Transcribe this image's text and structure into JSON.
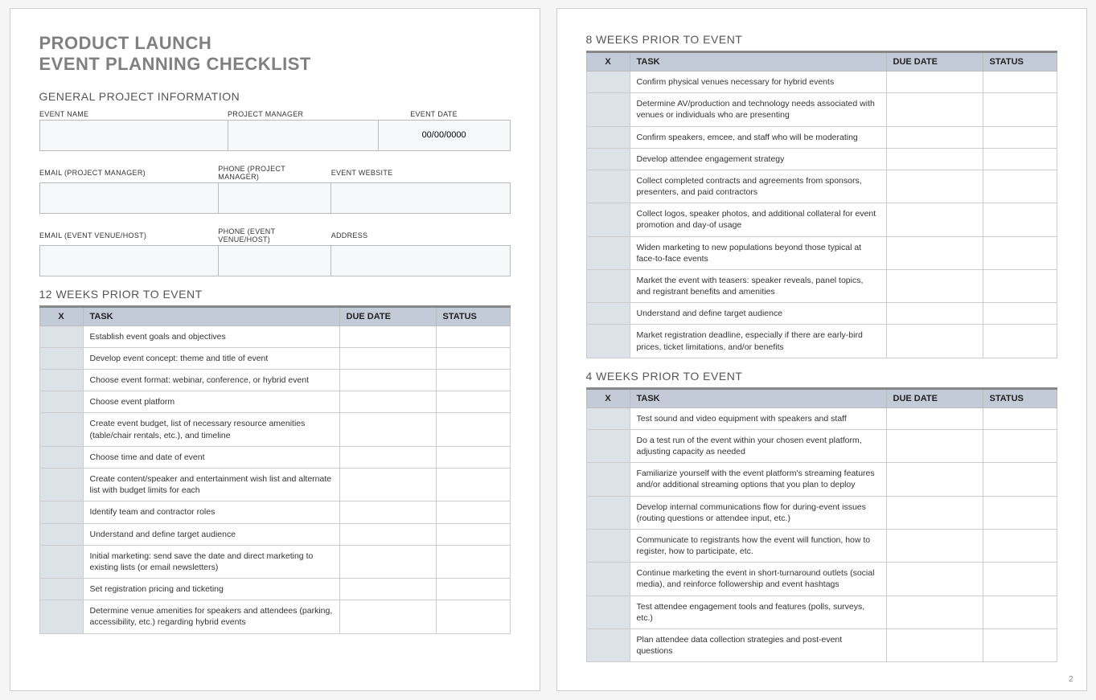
{
  "title_line1": "PRODUCT LAUNCH",
  "title_line2": "EVENT PLANNING CHECKLIST",
  "general_heading": "GENERAL PROJECT INFORMATION",
  "fields_row1": {
    "event_name_label": "EVENT NAME",
    "project_manager_label": "PROJECT MANAGER",
    "event_date_label": "EVENT DATE",
    "event_name_value": "",
    "project_manager_value": "",
    "event_date_value": "00/00/0000"
  },
  "fields_row2": {
    "email_pm_label": "EMAIL (PROJECT MANAGER)",
    "phone_pm_label": "PHONE (PROJECT MANAGER)",
    "website_label": "EVENT WEBSITE",
    "email_pm_value": "",
    "phone_pm_value": "",
    "website_value": ""
  },
  "fields_row3": {
    "email_venue_label": "EMAIL (EVENT VENUE/HOST)",
    "phone_venue_label": "PHONE (EVENT VENUE/HOST)",
    "address_label": "ADDRESS",
    "email_venue_value": "",
    "phone_venue_value": "",
    "address_value": ""
  },
  "columns": {
    "x": "X",
    "task": "TASK",
    "due": "DUE DATE",
    "status": "STATUS"
  },
  "sections": {
    "w12": {
      "heading": "12 WEEKS PRIOR TO EVENT",
      "tasks": [
        "Establish event goals and objectives",
        "Develop event concept: theme and title of event",
        "Choose event format: webinar, conference, or hybrid event",
        "Choose event platform",
        "Create event budget, list of necessary resource amenities (table/chair rentals, etc.), and timeline",
        "Choose time and date of event",
        "Create content/speaker and entertainment wish list and alternate list with budget limits for each",
        "Identify team and contractor roles",
        "Understand and define target audience",
        "Initial marketing: send save the date and direct marketing to existing lists (or email newsletters)",
        "Set registration pricing and ticketing",
        "Determine venue amenities for speakers and attendees (parking, accessibility, etc.) regarding hybrid events"
      ]
    },
    "w8": {
      "heading": "8 WEEKS PRIOR TO EVENT",
      "tasks": [
        "Confirm physical venues necessary for hybrid events",
        "Determine AV/production and technology needs associated with venues or individuals who are presenting",
        "Confirm speakers, emcee, and staff who will be moderating",
        "Develop attendee engagement strategy",
        "Collect completed contracts and agreements from sponsors, presenters, and paid contractors",
        "Collect logos, speaker photos, and additional collateral for event promotion and day-of usage",
        "Widen marketing to new populations beyond those typical at face-to-face events",
        "Market the event with teasers: speaker reveals, panel topics, and registrant benefits and amenities",
        "Understand and define target audience",
        "Market registration deadline, especially if there are early-bird prices, ticket limitations, and/or benefits"
      ]
    },
    "w4": {
      "heading": "4 WEEKS PRIOR TO EVENT",
      "tasks": [
        "Test sound and video equipment with speakers and staff",
        "Do a test run of the event within your chosen event platform, adjusting capacity as needed",
        "Familiarize yourself with the event platform's streaming features and/or additional streaming options that you plan to deploy",
        "Develop internal communications flow for during-event issues (routing questions or attendee input, etc.)",
        "Communicate to registrants how the event will function, how to register, how to participate, etc.",
        "Continue marketing the event in short-turnaround outlets (social media), and reinforce followership and event hashtags",
        "Test attendee engagement tools and features (polls, surveys, etc.)",
        "Plan attendee data collection strategies and post-event questions"
      ]
    }
  },
  "page_number": "2"
}
